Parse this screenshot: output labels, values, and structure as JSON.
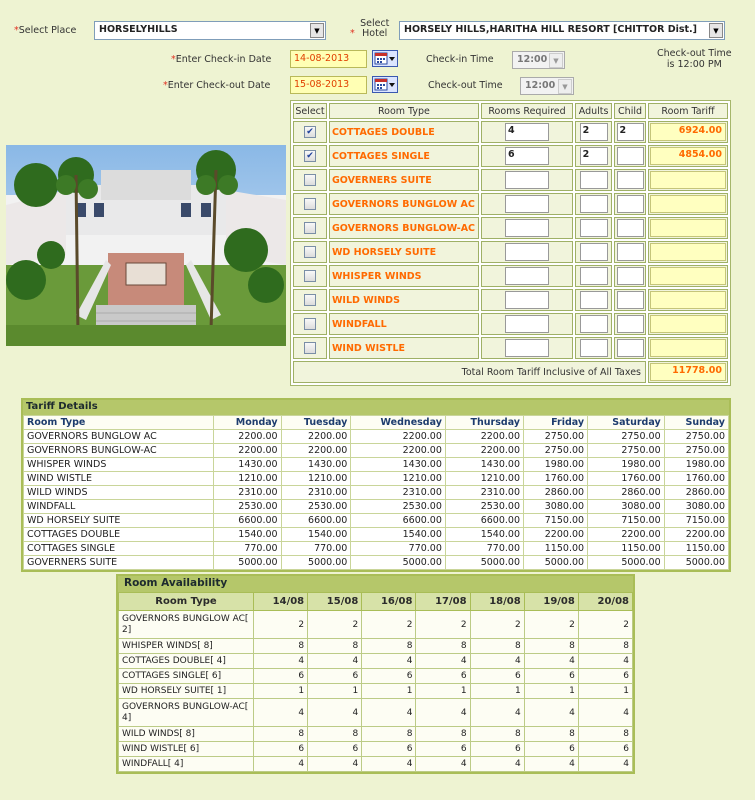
{
  "form": {
    "place_label": "Select Place",
    "place_value": "HORSELYHILLS",
    "hotel_label": "Select Hotel",
    "hotel_value": "HORSELY HILLS,HARITHA HILL RESORT [CHITTOR Dist.]",
    "checkin_date_label": "Enter Check-in Date",
    "checkin_date": "14-08-2013",
    "checkout_date_label": "Enter Check-out Date",
    "checkout_date": "15-08-2013",
    "checkin_time_label": "Check-in Time",
    "checkin_time": "12:00",
    "checkout_time_label": "Check-out Time",
    "checkout_time": "12:00",
    "checkout_note_line1": "Check-out Time",
    "checkout_note_line2": "is 12:00 PM",
    "required_marker": "*"
  },
  "rooms": {
    "headers": [
      "Select",
      "Room Type",
      "Rooms Required",
      "Adults",
      "Child",
      "Room Tariff"
    ],
    "rows": [
      {
        "checked": true,
        "name": "COTTAGES DOUBLE",
        "required": "4",
        "adults": "2",
        "child": "2",
        "tariff": "6924.00"
      },
      {
        "checked": true,
        "name": "COTTAGES SINGLE",
        "required": "6",
        "adults": "2",
        "child": "",
        "tariff": "4854.00"
      },
      {
        "checked": false,
        "name": "GOVERNERS SUITE",
        "required": "",
        "adults": "",
        "child": "",
        "tariff": ""
      },
      {
        "checked": false,
        "name": "GOVERNORS BUNGLOW AC",
        "required": "",
        "adults": "",
        "child": "",
        "tariff": ""
      },
      {
        "checked": false,
        "name": "GOVERNORS BUNGLOW-AC",
        "required": "",
        "adults": "",
        "child": "",
        "tariff": ""
      },
      {
        "checked": false,
        "name": "WD HORSELY SUITE",
        "required": "",
        "adults": "",
        "child": "",
        "tariff": ""
      },
      {
        "checked": false,
        "name": "WHISPER WINDS",
        "required": "",
        "adults": "",
        "child": "",
        "tariff": ""
      },
      {
        "checked": false,
        "name": "WILD WINDS",
        "required": "",
        "adults": "",
        "child": "",
        "tariff": ""
      },
      {
        "checked": false,
        "name": "WINDFALL",
        "required": "",
        "adults": "",
        "child": "",
        "tariff": ""
      },
      {
        "checked": false,
        "name": "WIND WISTLE",
        "required": "",
        "adults": "",
        "child": "",
        "tariff": ""
      }
    ],
    "total_label": "Total Room Tariff Inclusive of All Taxes",
    "total_value": "11778.00"
  },
  "tariff": {
    "title": "Tariff Details",
    "headers": [
      "Room Type",
      "Monday",
      "Tuesday",
      "Wednesday",
      "Thursday",
      "Friday",
      "Saturday",
      "Sunday"
    ],
    "rows": [
      [
        "GOVERNORS BUNGLOW AC",
        "2200.00",
        "2200.00",
        "2200.00",
        "2200.00",
        "2750.00",
        "2750.00",
        "2750.00"
      ],
      [
        "GOVERNORS BUNGLOW-AC",
        "2200.00",
        "2200.00",
        "2200.00",
        "2200.00",
        "2750.00",
        "2750.00",
        "2750.00"
      ],
      [
        "WHISPER WINDS",
        "1430.00",
        "1430.00",
        "1430.00",
        "1430.00",
        "1980.00",
        "1980.00",
        "1980.00"
      ],
      [
        "WIND WISTLE",
        "1210.00",
        "1210.00",
        "1210.00",
        "1210.00",
        "1760.00",
        "1760.00",
        "1760.00"
      ],
      [
        "WILD WINDS",
        "2310.00",
        "2310.00",
        "2310.00",
        "2310.00",
        "2860.00",
        "2860.00",
        "2860.00"
      ],
      [
        "WINDFALL",
        "2530.00",
        "2530.00",
        "2530.00",
        "2530.00",
        "3080.00",
        "3080.00",
        "3080.00"
      ],
      [
        "WD HORSELY SUITE",
        "6600.00",
        "6600.00",
        "6600.00",
        "6600.00",
        "7150.00",
        "7150.00",
        "7150.00"
      ],
      [
        "COTTAGES DOUBLE",
        "1540.00",
        "1540.00",
        "1540.00",
        "1540.00",
        "2200.00",
        "2200.00",
        "2200.00"
      ],
      [
        "COTTAGES SINGLE",
        "770.00",
        "770.00",
        "770.00",
        "770.00",
        "1150.00",
        "1150.00",
        "1150.00"
      ],
      [
        "GOVERNERS SUITE",
        "5000.00",
        "5000.00",
        "5000.00",
        "5000.00",
        "5000.00",
        "5000.00",
        "5000.00"
      ]
    ]
  },
  "availability": {
    "title": "Room Availability",
    "headers": [
      "Room Type",
      "14/08",
      "15/08",
      "16/08",
      "17/08",
      "18/08",
      "19/08",
      "20/08"
    ],
    "rows": [
      [
        "GOVERNORS BUNGLOW AC[ 2]",
        "2",
        "2",
        "2",
        "2",
        "2",
        "2",
        "2"
      ],
      [
        "WHISPER WINDS[ 8]",
        "8",
        "8",
        "8",
        "8",
        "8",
        "8",
        "8"
      ],
      [
        "COTTAGES DOUBLE[ 4]",
        "4",
        "4",
        "4",
        "4",
        "4",
        "4",
        "4"
      ],
      [
        "COTTAGES SINGLE[ 6]",
        "6",
        "6",
        "6",
        "6",
        "6",
        "6",
        "6"
      ],
      [
        "WD HORSELY SUITE[ 1]",
        "1",
        "1",
        "1",
        "1",
        "1",
        "1",
        "1"
      ],
      [
        "GOVERNORS BUNGLOW-AC[ 4]",
        "4",
        "4",
        "4",
        "4",
        "4",
        "4",
        "4"
      ],
      [
        "WILD WINDS[ 8]",
        "8",
        "8",
        "8",
        "8",
        "8",
        "8",
        "8"
      ],
      [
        "WIND WISTLE[ 6]",
        "6",
        "6",
        "6",
        "6",
        "6",
        "6",
        "6"
      ],
      [
        "WINDFALL[ 4]",
        "4",
        "4",
        "4",
        "4",
        "4",
        "4",
        "4"
      ]
    ]
  },
  "colors": {
    "accent": "#ff6a00",
    "header_green": "#b5c76a",
    "background": "#eef3d2"
  },
  "icons": {
    "calendar": "calendar-icon",
    "dropdown": "chevron-down-icon",
    "checkbox": "check-icon"
  }
}
